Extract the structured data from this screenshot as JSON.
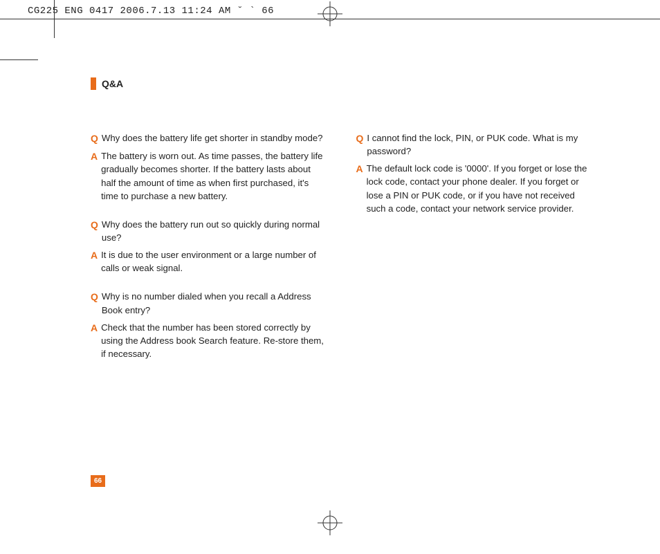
{
  "header": "CG225 ENG 0417  2006.7.13 11:24 AM  ˘  ` 66",
  "section_title": "Q&A",
  "q_label": "Q",
  "a_label": "A",
  "left_col": [
    {
      "q": "Why does the battery life get shorter in standby mode?",
      "a": "The battery is worn out. As time passes, the battery life gradually becomes shorter. If the battery lasts about half the amount of time as when first purchased, it's time to purchase a new battery."
    },
    {
      "q": "Why does the battery run out so quickly during normal use?",
      "a": "It is due to the user environment or a large number of calls or weak signal."
    },
    {
      "q": "Why is no number dialed when you recall a Address Book entry?",
      "a": "Check that the number has been stored correctly by using the Address book Search feature. Re-store them, if necessary."
    }
  ],
  "right_col": [
    {
      "q": "I cannot find the lock, PIN, or PUK code. What is my password?",
      "a": "The default lock code is '0000'. If you forget or lose the lock code, contact your phone dealer. If you forget or lose a PIN or PUK code, or if you have not received such a code, contact your network service provider."
    }
  ],
  "page_number": "66"
}
